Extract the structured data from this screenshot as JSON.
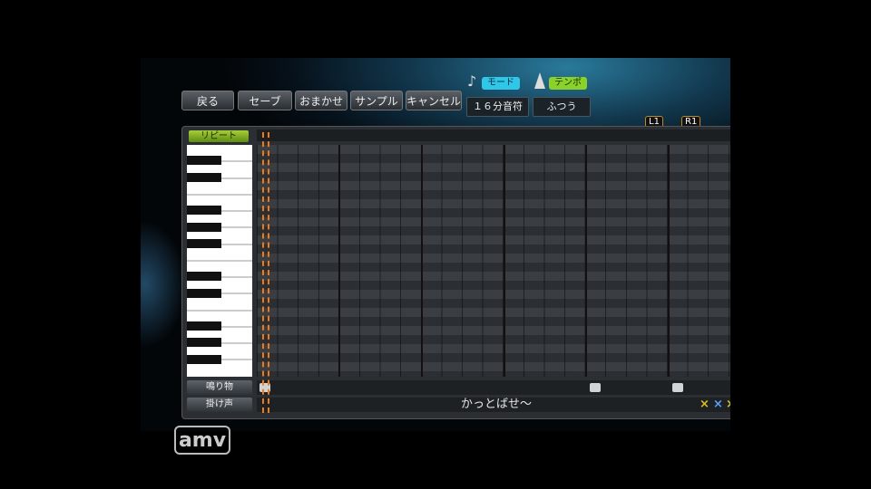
{
  "toolbar": {
    "back": "戻る",
    "save": "セーブ",
    "omakase": "おまかせ",
    "sample": "サンプル",
    "cancel": "キャンセル"
  },
  "mode": {
    "label": "モード",
    "value": "１６分音符"
  },
  "tempo": {
    "label": "テンポ",
    "value": "ふつう"
  },
  "shoulders": {
    "l1": "L1",
    "r1": "R1"
  },
  "repeat_label": "リピート",
  "tracks": {
    "narimono_label": "鳴り物",
    "kakegoe_label": "掛け声",
    "kakegoe_text": "かっとばせ～",
    "x_marks": [
      "×",
      "×",
      "×"
    ]
  },
  "colors": {
    "accent_orange": "#f07a18",
    "repeat_green": "#8fbf2a",
    "mode_cyan": "#2fc6e8",
    "tempo_green": "#8ad12a",
    "x_yellow": "#e0c020",
    "x_blue": "#5aa0ff"
  },
  "logo": "amv"
}
